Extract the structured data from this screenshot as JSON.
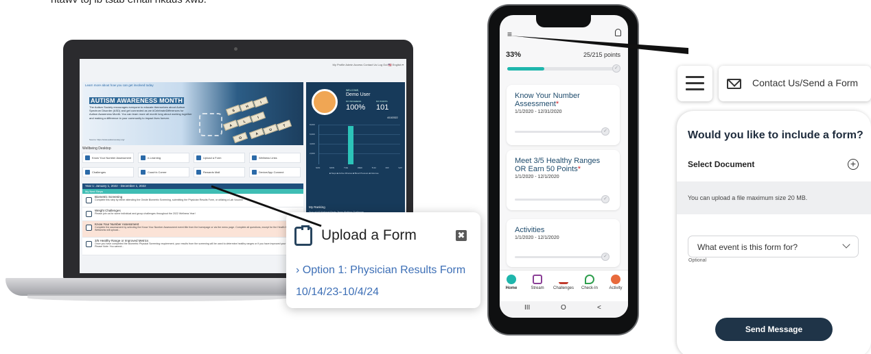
{
  "caption": "ntawv toj ib tsab email nkaus xwb.",
  "desktop": {
    "topnav": "My Profile  Admin Access  Contact Us  Log Out  🇺🇸 English ▾",
    "learn_link": "Learn more about how you can get involved today",
    "hero": {
      "title": "AUTISM AWARENESS MONTH",
      "text": "The Autism Society encourages everyone to educate themselves about Autism Spectrum Disorder (ASD) and get connected as we #CelebrateDifferences for Autism Awareness Month. You can learn more all month long about working together and making a difference in your community to impact lives forever.",
      "source": "Source: https://www.autismsociety.org/",
      "tiles": [
        "S",
        "H",
        "I",
        "N",
        "E",
        "A",
        "L",
        "I",
        "G",
        "H",
        "T",
        "O",
        "N",
        "A",
        "U",
        "T",
        "I",
        "S",
        "M"
      ]
    },
    "profile": {
      "welcome": "WELCOME,",
      "name": "Demo User",
      "progress_label": "MY PROGRESS",
      "progress_value": "100%",
      "progress_sub": "2 of 2",
      "points_label": "MY POINTS",
      "points_value": "101",
      "date": "4/10/2022",
      "ylabels": [
        "8,000",
        "6,000",
        "4,000",
        "2,000"
      ],
      "days": [
        "SUN",
        "MON",
        "TUE",
        "WED",
        "THU",
        "FRI",
        "SAT"
      ],
      "legend": "■ Steps  ■ Active Minutes  ■ Blood Pressure  ■ Glucose"
    },
    "wellbeing_title": "Wellbeing Desktop",
    "buttons": [
      "Know Your Number Assessment",
      "e-Learning",
      "Upload a Form",
      "Wellness Links",
      "Challenges",
      "Coach's Corner",
      "Rewards Mall",
      "Device/App Connect"
    ],
    "year_bar": "Year 1: January 1, 2022 - December 1, 2022",
    "steps_bar": "My Next Steps",
    "steps": [
      {
        "title": "Biometric Screening",
        "text": "Complete this step by either attending the Onsite Biometric Screening, submitting the Physician Results Form, or utilizing a Lab Voucher"
      },
      {
        "title": "Weight Challenges",
        "text": "Please join us for some individual and group challenges throughout the 2022 Wellness Year!"
      },
      {
        "title": "Know Your Number Assessment",
        "text": "Complete the assessment by selecting the Know Your Number Assessment event title from the homepage or via the menu page. Complete all questions, except for the Health Metrics section. Wellworks will upload..."
      },
      {
        "title": "3/5 Healthy Range or Improved Metrics",
        "text": "Once you have completed the Biometric Physical Screening requirement, your results from the screening will be used to determine healthy ranges or if you have improved your metrics. Please Note: You cannot..."
      }
    ],
    "ranking": {
      "title": "My Ranking",
      "sub": "Tour of US National Parks Team Walking Challenge",
      "rows": [
        "Smokey Mountain National Park",
        "Laurel Test Team"
      ]
    }
  },
  "upload_popup": {
    "title": "Upload a Form",
    "close": "✖",
    "link_line1": "› Option 1: Physician Results Form",
    "link_line2": "10/14/23-10/4/24"
  },
  "phone": {
    "menu": "≡",
    "percent": "33%",
    "points": "25/215 points",
    "progress_value": 0.33,
    "cards": [
      {
        "title": "Know Your Number Assessment",
        "required": "*",
        "dates": "1/1/2020 - 12/31/2020"
      },
      {
        "title": "Meet 3/5 Healthy Ranges OR Earn 50 Points",
        "required": "*",
        "dates": "1/1/2020 - 12/1/2020"
      },
      {
        "title": "Activities",
        "required": "",
        "dates": "1/1/2020 - 12/1/2020"
      }
    ],
    "nav": [
      "Home",
      "Stream",
      "Challenges",
      "Check-In",
      "Activity"
    ],
    "system": [
      "III",
      "O",
      "<"
    ]
  },
  "contact": {
    "button_label": "Contact Us/Send a Form",
    "question": "Would you like to include a form?",
    "select_document": "Select Document",
    "plus": "+",
    "info": "You can upload a file maximum size 20 MB.",
    "event_select": "What event is this form for?",
    "optional": "Optional",
    "send": "Send Message"
  },
  "colors": {
    "navy": "#1f3448",
    "teal": "#1fb6ac",
    "link": "#3d6fb6",
    "required": "#d2232a"
  }
}
